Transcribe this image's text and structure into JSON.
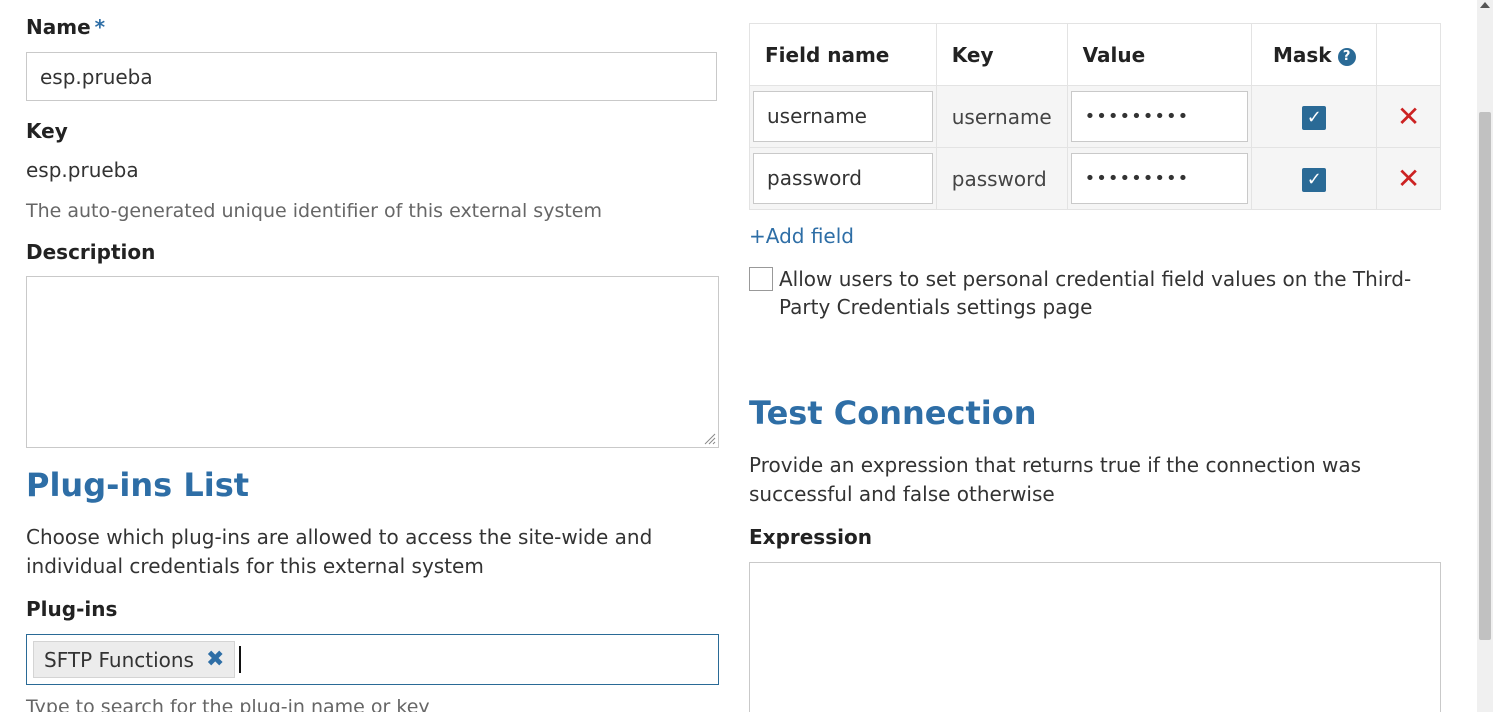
{
  "form": {
    "name_label": "Name",
    "required_mark": "*",
    "name_value": "esp.prueba",
    "key_label": "Key",
    "key_value": "esp.prueba",
    "key_help": "The auto-generated unique identifier of this external system",
    "description_label": "Description",
    "description_value": ""
  },
  "plugins": {
    "title": "Plug-ins List",
    "description": "Choose which plug-ins are allowed to access the site-wide and individual credentials for this external system",
    "label": "Plug-ins",
    "selected": [
      "SFTP Functions"
    ],
    "help": "Type to search for the plug-in name or key"
  },
  "credentials": {
    "headers": {
      "field_name": "Field name",
      "key": "Key",
      "value": "Value",
      "mask": "Mask",
      "help_glyph": "?"
    },
    "rows": [
      {
        "field_name": "username",
        "key": "username",
        "value": "•••••••••",
        "masked": true
      },
      {
        "field_name": "password",
        "key": "password",
        "value": "•••••••••",
        "masked": true
      }
    ],
    "add_field": "+Add field",
    "allow_personal": "Allow users to set personal credential field values on the Third-Party Credentials settings page",
    "allow_personal_checked": false
  },
  "test_connection": {
    "title": "Test Connection",
    "description": "Provide an expression that returns true if the connection was successful and false otherwise",
    "expression_label": "Expression",
    "expression_value": ""
  },
  "icons": {
    "check": "✓",
    "remove": "✕",
    "tag_remove": "✖"
  },
  "colors": {
    "accent": "#2e6ea6",
    "danger": "#cc2222",
    "checkbox": "#2a6a96"
  }
}
